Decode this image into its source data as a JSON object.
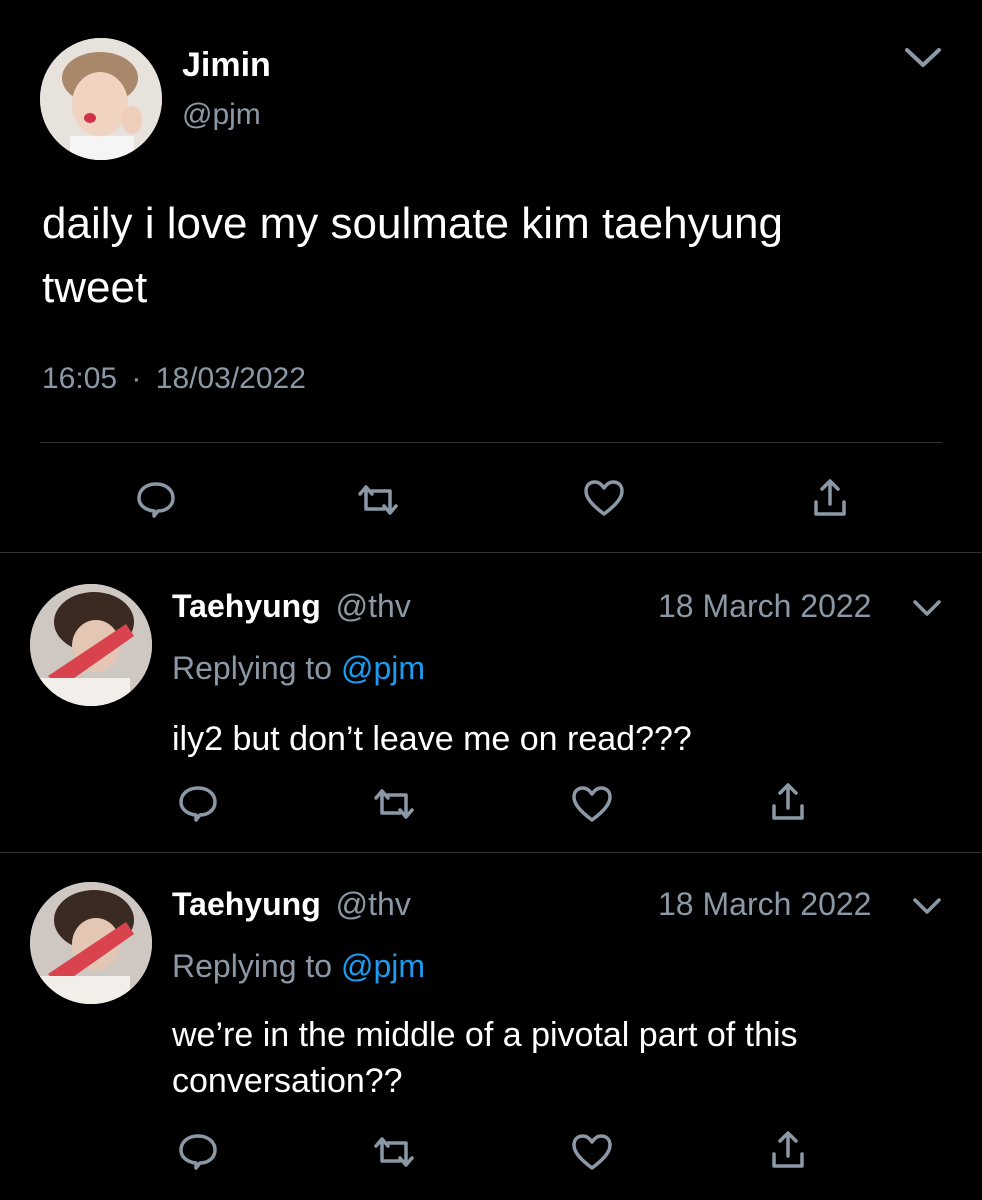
{
  "main_tweet": {
    "author_name": "Jimin",
    "author_handle": "@pjm",
    "text_line1": "daily i love my soulmate kim taehyung",
    "text_line2": "tweet",
    "time": "16:05",
    "separator": "·",
    "date": "18/03/2022"
  },
  "replies": [
    {
      "author_name": "Taehyung",
      "author_handle": "@thv",
      "date": "18 March 2022",
      "replying_label": "Replying to",
      "replying_handle": "@pjm",
      "text_line1": "ily2 but don’t leave me on read???",
      "text_line2": ""
    },
    {
      "author_name": "Taehyung",
      "author_handle": "@thv",
      "date": "18 March 2022",
      "replying_label": "Replying to",
      "replying_handle": "@pjm",
      "text_line1": "we’re in the middle of a pivotal part of this",
      "text_line2": "conversation??"
    }
  ],
  "icons": [
    "reply-icon",
    "retweet-icon",
    "like-icon",
    "share-icon",
    "chevron-down-icon"
  ],
  "colors": {
    "background": "#000000",
    "muted": "#8b98a5",
    "link": "#1d9bf0",
    "divider": "#2f3336"
  }
}
